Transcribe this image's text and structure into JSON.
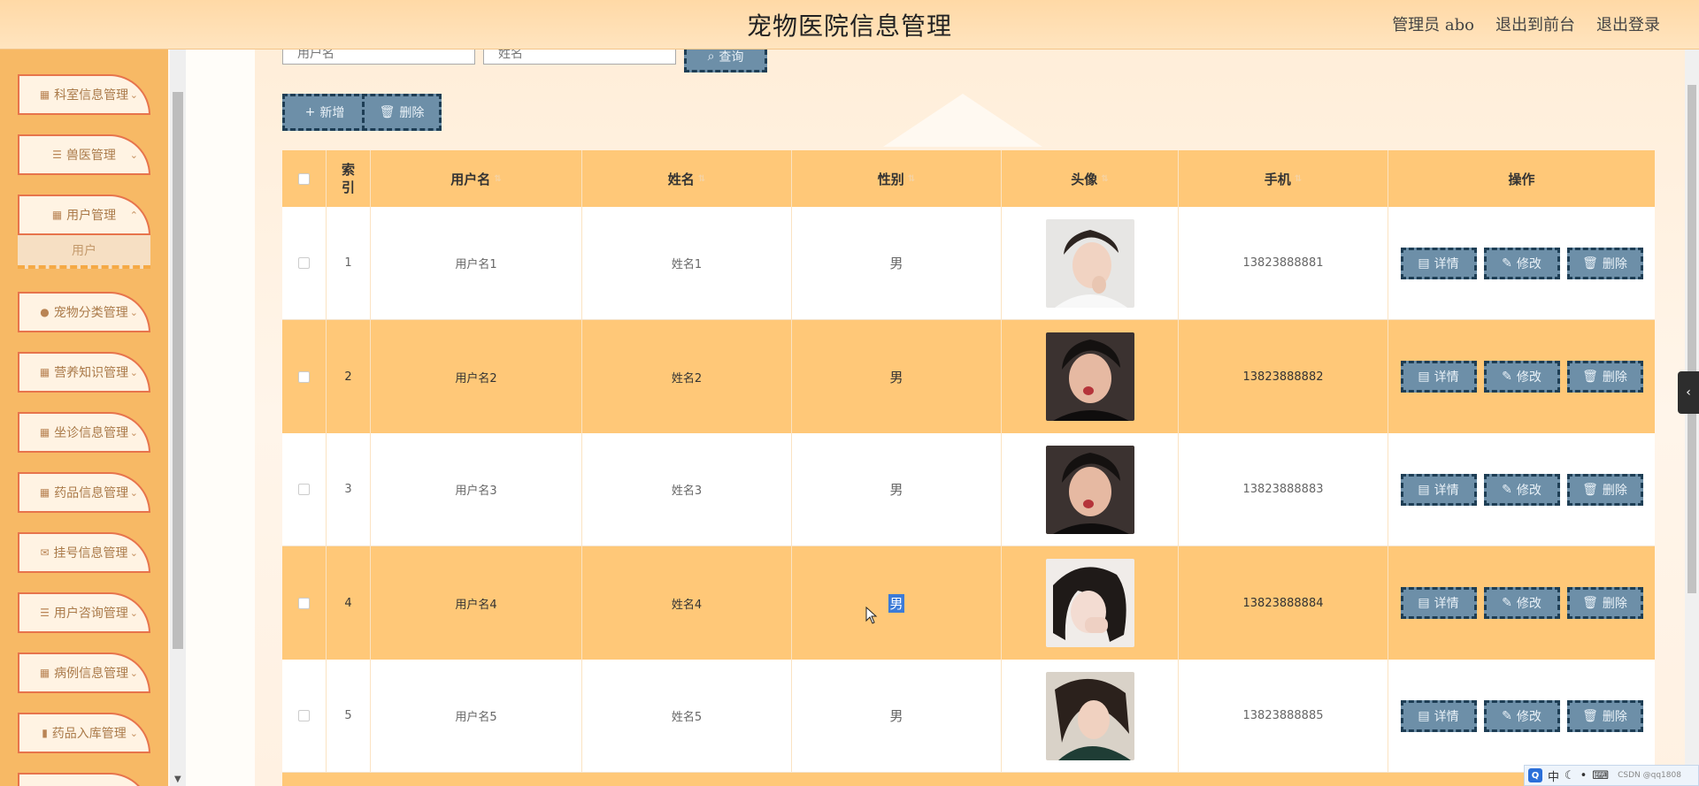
{
  "header": {
    "title": "宠物医院信息管理",
    "admin_label": "管理员 abo",
    "to_front": "退出到前台",
    "logout": "退出登录"
  },
  "sidebar": {
    "items": [
      {
        "label": "科室信息管理",
        "icon": "grid-icon",
        "has_chevron": true
      },
      {
        "label": "兽医管理",
        "icon": "list-icon",
        "has_chevron": true
      },
      {
        "label": "用户管理",
        "icon": "grid-icon",
        "has_chevron": true
      },
      {
        "label": "宠物分类管理",
        "icon": "person-icon",
        "has_chevron": true
      },
      {
        "label": "营养知识管理",
        "icon": "grid-icon",
        "has_chevron": true
      },
      {
        "label": "坐诊信息管理",
        "icon": "grid-icon",
        "has_chevron": true
      },
      {
        "label": "药品信息管理",
        "icon": "grid-icon",
        "has_chevron": true
      },
      {
        "label": "挂号信息管理",
        "icon": "ticket-icon",
        "has_chevron": true
      },
      {
        "label": "用户咨询管理",
        "icon": "list-icon",
        "has_chevron": true
      },
      {
        "label": "病例信息管理",
        "icon": "grid-icon",
        "has_chevron": true
      },
      {
        "label": "药品入库管理",
        "icon": "bar-chart-icon",
        "has_chevron": true
      }
    ],
    "submenu_label": "用户"
  },
  "search": {
    "username_placeholder": "用户名",
    "name_placeholder": "姓名",
    "query_label": "查询"
  },
  "toolbar": {
    "add_label": "新增",
    "delete_label": "删除"
  },
  "table": {
    "headers": {
      "index": "索引",
      "username": "用户名",
      "name": "姓名",
      "gender": "性别",
      "avatar": "头像",
      "phone": "手机",
      "actions": "操作"
    },
    "rows": [
      {
        "index": "1",
        "username": "用户名1",
        "name": "姓名1",
        "gender": "男",
        "phone": "13823888881"
      },
      {
        "index": "2",
        "username": "用户名2",
        "name": "姓名2",
        "gender": "男",
        "phone": "13823888882"
      },
      {
        "index": "3",
        "username": "用户名3",
        "name": "姓名3",
        "gender": "男",
        "phone": "13823888883"
      },
      {
        "index": "4",
        "username": "用户名4",
        "name": "姓名4",
        "gender": "男",
        "phone": "13823888884"
      },
      {
        "index": "5",
        "username": "用户名5",
        "name": "姓名5",
        "gender": "男",
        "phone": "13823888885"
      }
    ],
    "row_actions": {
      "detail": "详情",
      "edit": "修改",
      "delete": "删除"
    }
  },
  "ime": {
    "lang": "中",
    "watermark": "CSDN @qq1808"
  },
  "colors": {
    "header_bg": "#ffd9a6",
    "sidebar_bg": "#f7b965",
    "menu_border": "#e7744c",
    "table_header": "#ffc878",
    "button_bg": "#6d8fa8",
    "button_border": "#1e3e55",
    "selection": "#3c7bd8"
  }
}
